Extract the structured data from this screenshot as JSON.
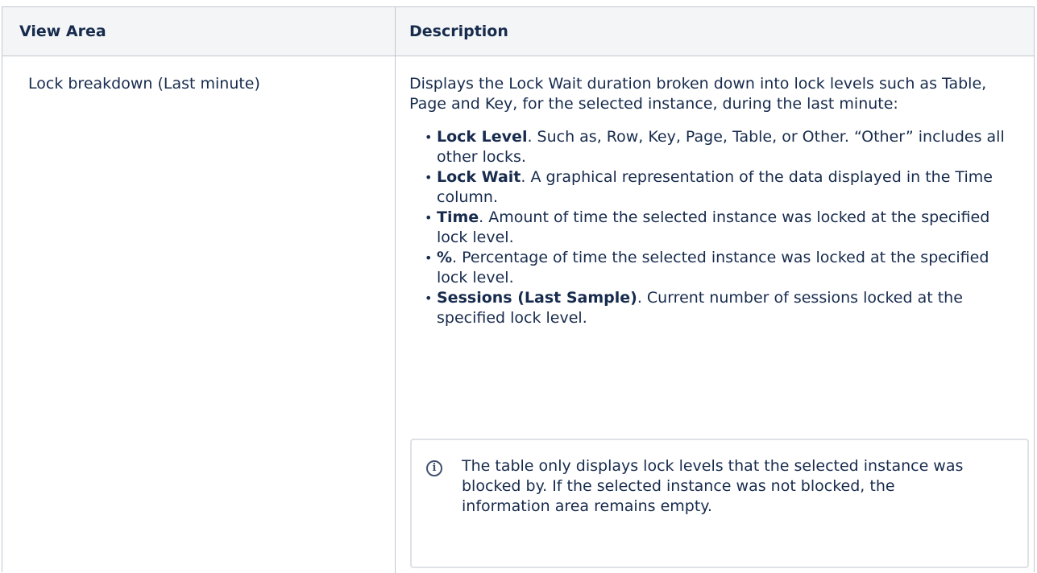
{
  "table": {
    "headers": {
      "view_area": "View Area",
      "description": "Description"
    },
    "rows": [
      {
        "view_area": "Lock breakdown (Last minute)",
        "intro": "Displays the Lock Wait duration broken down into lock levels such as Table, Page and Key, for the selected instance, during the last minute:",
        "bullets": [
          {
            "term": "Lock Level",
            "text": ". Such as, Row, Key, Page, Table, or Other. “Other” includes all other locks."
          },
          {
            "term": "Lock Wait",
            "text": ". A graphical representation of the data displayed in the Time column."
          },
          {
            "term": "Time",
            "text": ". Amount of time the selected instance was locked at the specified lock level."
          },
          {
            "term": "%",
            "text": ". Percentage of time the selected instance was locked at the specified lock level."
          },
          {
            "term": "Sessions (Last Sample)",
            "text": ". Current number of sessions locked at the specified lock level."
          }
        ],
        "info_panel": {
          "icon": "info-icon",
          "text": "The table only displays lock levels that the selected instance was blocked by. If the selected instance was not blocked, the information area remains empty."
        }
      }
    ]
  }
}
